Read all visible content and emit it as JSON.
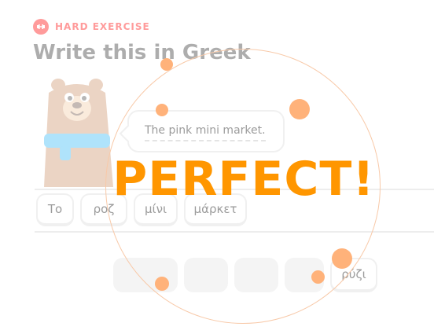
{
  "header": {
    "badge_label": "HARD EXERCISE",
    "title": "Write this in Greek",
    "badge_icon": "dumbbell-icon",
    "badge_color": "#ff4b4b"
  },
  "prompt": {
    "text": "The pink mini market."
  },
  "answer": {
    "tiles": [
      "Το",
      "ροζ",
      "μίνι",
      "μάρκετ"
    ]
  },
  "word_bank": {
    "tiles": [
      "ρύζι"
    ]
  },
  "feedback": {
    "text": "PERFECT!",
    "color": "#ff9600"
  }
}
